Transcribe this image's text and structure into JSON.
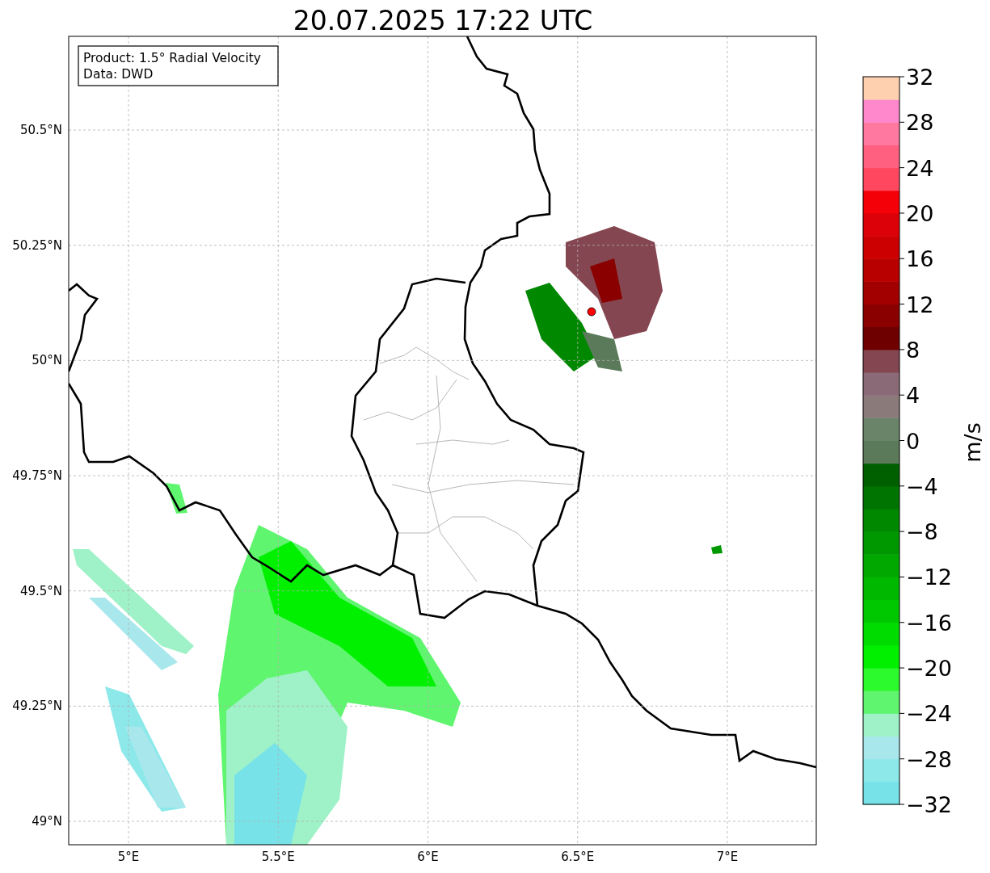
{
  "title": "20.07.2025 17:22 UTC",
  "legend": {
    "lines": [
      "Product: 1.5° Radial Velocity",
      "Data: DWD"
    ]
  },
  "y_ticks": [
    "50.5°N",
    "50.25°N",
    "50°N",
    "49.75°N",
    "49.5°N",
    "49.25°N",
    "49°N"
  ],
  "x_ticks": [
    "5°E",
    "5.5°E",
    "6°E",
    "6.5°E",
    "7°E"
  ],
  "colorbar": {
    "label": "m/s",
    "ticks": [
      "32",
      "28",
      "24",
      "20",
      "16",
      "12",
      "8",
      "4",
      "0",
      "−4",
      "−8",
      "−12",
      "−16",
      "−20",
      "−24",
      "−28",
      "−32"
    ],
    "bins": [
      {
        "color": "#77e3e8"
      },
      {
        "color": "#8de8ea"
      },
      {
        "color": "#a8e8ec"
      },
      {
        "color": "#9ff2c8"
      },
      {
        "color": "#5ff56f"
      },
      {
        "color": "#2dfa2d"
      },
      {
        "color": "#00f000"
      },
      {
        "color": "#00dc00"
      },
      {
        "color": "#00c800"
      },
      {
        "color": "#00b800"
      },
      {
        "color": "#00a800"
      },
      {
        "color": "#009800"
      },
      {
        "color": "#008800"
      },
      {
        "color": "#007400"
      },
      {
        "color": "#006000"
      },
      {
        "color": "#5a7a5a"
      },
      {
        "color": "#6a846a"
      },
      {
        "color": "#8a7a7a"
      },
      {
        "color": "#8a6a76"
      },
      {
        "color": "#844650"
      },
      {
        "color": "#6e0000"
      },
      {
        "color": "#8a0000"
      },
      {
        "color": "#a20000"
      },
      {
        "color": "#b80000"
      },
      {
        "color": "#cc0000"
      },
      {
        "color": "#dc0008"
      },
      {
        "color": "#f40008"
      },
      {
        "color": "#ff4860"
      },
      {
        "color": "#ff6080"
      },
      {
        "color": "#ff78a0"
      },
      {
        "color": "#ff88cc"
      },
      {
        "color": "#ffd0b0"
      }
    ]
  }
}
